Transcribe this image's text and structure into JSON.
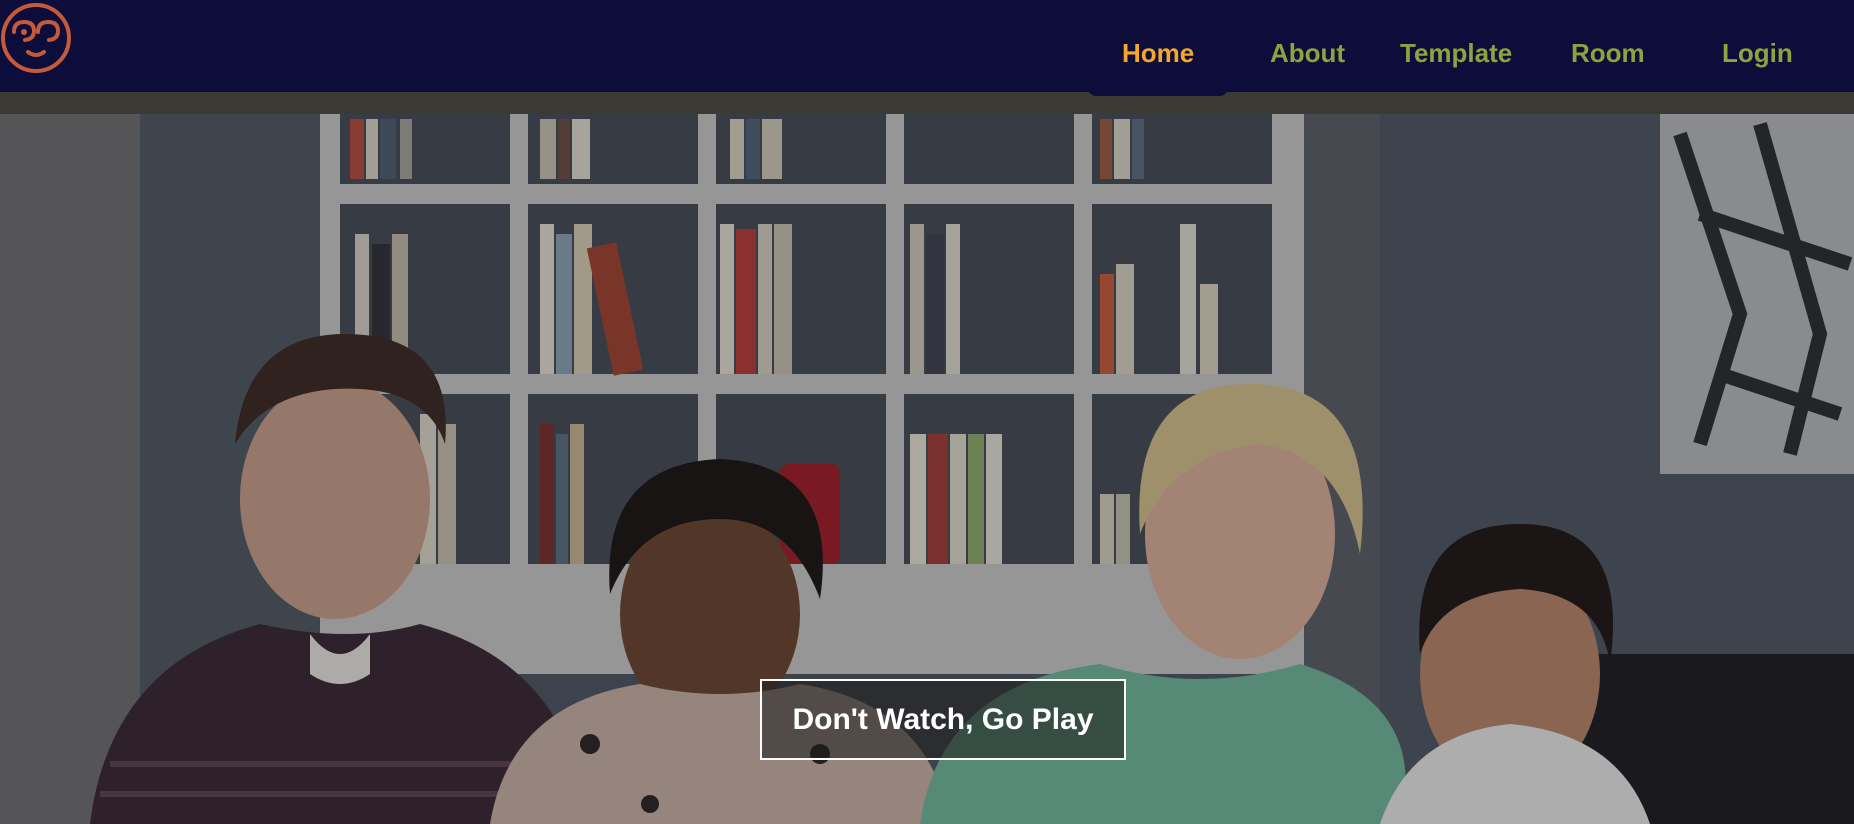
{
  "header": {
    "logo_icon": "pawn-logo-icon",
    "logo_color": "#c55a3b",
    "background": "#0c0d3a",
    "nav": [
      {
        "label": "Home",
        "active": true
      },
      {
        "label": "About",
        "active": false
      },
      {
        "label": "Template",
        "active": false
      },
      {
        "label": "Room",
        "active": false
      },
      {
        "label": "Login",
        "active": false
      }
    ],
    "active_color": "#f4a72c",
    "inactive_color": "#8fa23c"
  },
  "hero": {
    "image": "hero-image-friends-laughing",
    "cta_label": "Don't Watch, Go Play"
  }
}
